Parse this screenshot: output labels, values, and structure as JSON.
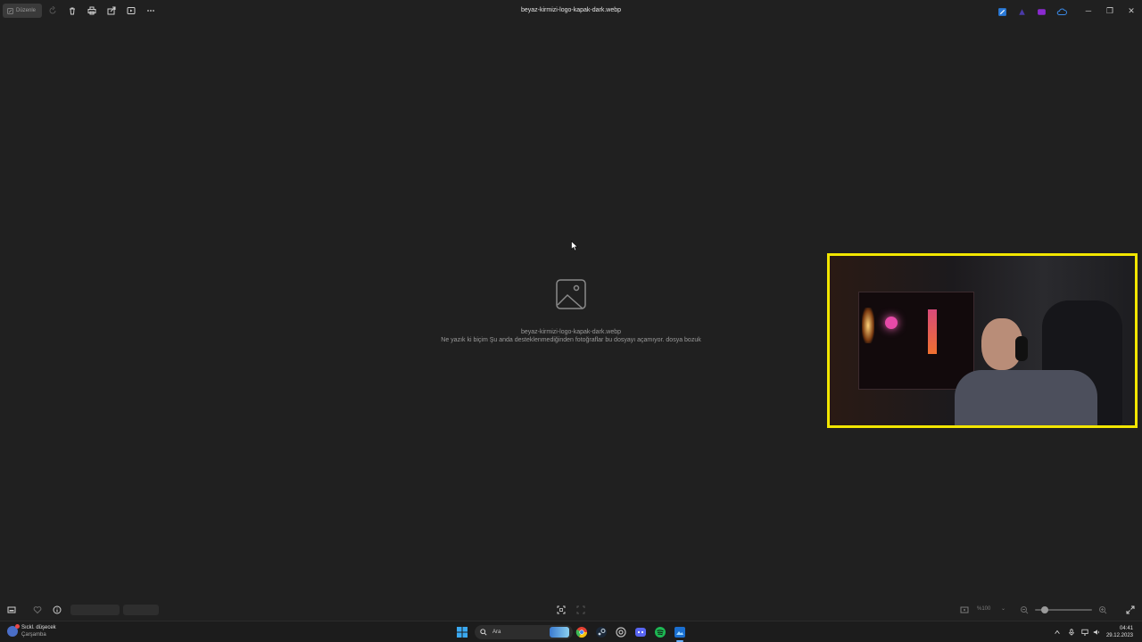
{
  "window": {
    "title": "beyaz-kirmizi-logo-kapak-dark.webp",
    "edit_label": "Düzenle",
    "minimize": "─",
    "maximize": "❐",
    "close": "✕"
  },
  "toolbar_icons": [
    "rotate-icon",
    "delete-icon",
    "print-icon",
    "share-icon",
    "slideshow-icon",
    "more-icon"
  ],
  "viewer": {
    "filename": "beyaz-kirmizi-logo-kapak-dark.webp",
    "message": "Ne yazık ki biçim Şu anda desteklenmediğinden fotoğraflar bu dosyayı açamıyor. dosya bozuk"
  },
  "bottom": {
    "zoom_label": "%100"
  },
  "taskbar": {
    "weather_line1": "Sıckl. düşecek",
    "weather_line2": "Çarşamba",
    "search_placeholder": "Ara",
    "time": "04:41",
    "date": "29.12.2023"
  },
  "colors": {
    "background": "#202020",
    "webcam_border": "#f2e600",
    "taskbar": "#1c1c1c",
    "accent": "#6ab0ff"
  }
}
